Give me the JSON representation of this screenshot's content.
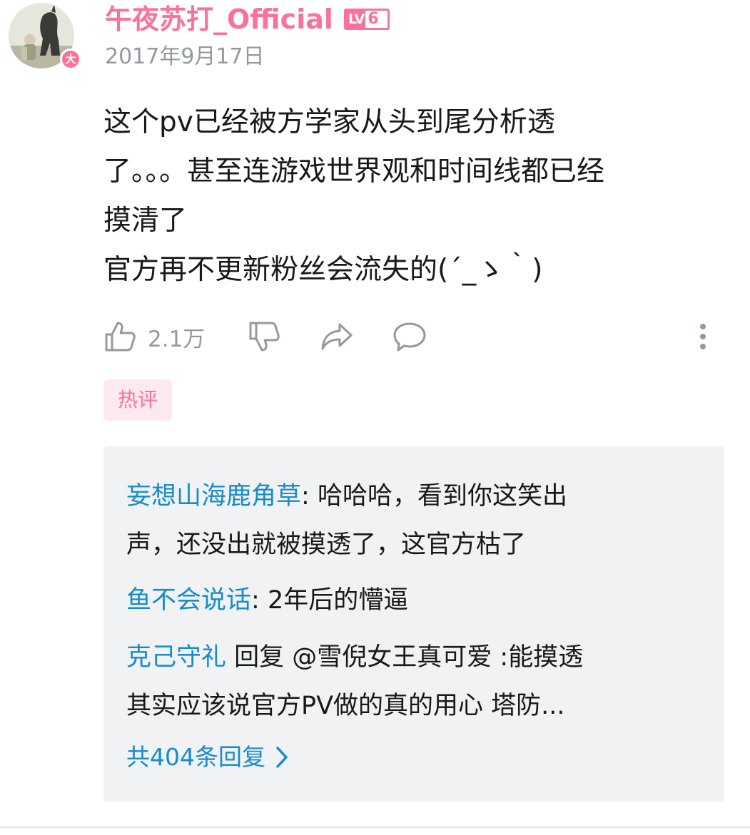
{
  "comment": {
    "author": {
      "name": "午夜苏打_Official",
      "level_prefix": "LV",
      "level_number": "6",
      "avatar_badge": "大",
      "avatar_icon": "avatar-image"
    },
    "date": "2017年9月17日",
    "content_lines": [
      "这个pv已经被方学家从头到尾分析透",
      "了。。。甚至连游戏世界观和时间线都已经",
      "摸清了",
      "官方再不更新粉丝会流失的(´_ゝ｀)"
    ],
    "actions": {
      "like_icon": "thumbs-up-icon",
      "like_count": "2.1万",
      "dislike_icon": "thumbs-down-icon",
      "share_icon": "share-icon",
      "reply_icon": "comment-bubble-icon",
      "more_icon": "more-vertical-icon"
    },
    "hot_tag": "热评"
  },
  "replies": [
    {
      "user": "妄想山海鹿角草",
      "separator": ": ",
      "text_line1": "哈哈哈，看到你这笑出",
      "text_line2": "声，还没出就被摸透了，这官方枯了"
    },
    {
      "user": "鱼不会说话",
      "separator": ": ",
      "text_line1": "2年后的懵逼"
    },
    {
      "user": "克己守礼",
      "separator": " 回复 @雪倪女王真可爱 :",
      "text_line1": "能摸透",
      "text_line2": "其实应该说官方PV做的真的用心 塔防..."
    }
  ],
  "more_replies": {
    "label": "共404条回复",
    "icon": "chevron-right-icon"
  },
  "colors": {
    "accent_pink": "#fb7299",
    "link_blue": "#178bcf",
    "muted_gray": "#9499a0",
    "reply_bg": "#f1f2f3"
  }
}
